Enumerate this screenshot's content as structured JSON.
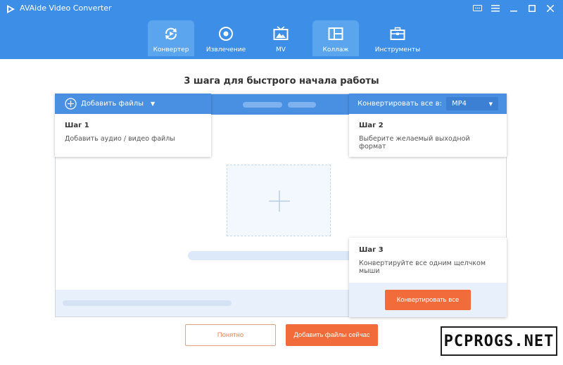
{
  "window": {
    "title": "AVAide Video Converter",
    "controls": [
      "feedback",
      "menu",
      "minimize",
      "maximize",
      "close"
    ]
  },
  "nav": {
    "tabs": [
      {
        "label": "Конвертер",
        "icon": "convert-icon",
        "active": true
      },
      {
        "label": "Извлечение",
        "icon": "rip-icon",
        "active": false
      },
      {
        "label": "MV",
        "icon": "mv-icon",
        "active": false
      },
      {
        "label": "Коллаж",
        "icon": "collage-icon",
        "active": false
      },
      {
        "label": "Инструменты",
        "icon": "toolbox-icon",
        "active": false
      }
    ]
  },
  "tutorial": {
    "headline": "3 шага для быстрого начала работы",
    "add_files_label": "Добавить файлы",
    "convert_all_to_label": "Конвертировать все в:",
    "format_value": "MP4",
    "steps": [
      {
        "title": "Шаг 1",
        "desc": "Добавить аудио / видео файлы"
      },
      {
        "title": "Шаг 2",
        "desc": "Выберите желаемый выходной формат"
      },
      {
        "title": "Шаг 3",
        "desc": "Конвертируйте все одним щелчком мыши"
      }
    ],
    "convert_all_button": "Конвертировать все",
    "got_it_button": "Понятно",
    "add_now_button": "Добавить файлы сейчас"
  },
  "colors": {
    "header_blue": "#3d8ee6",
    "accent_blue": "#4a90e2",
    "accent_orange": "#f26b3a"
  },
  "watermark": "PCPROGS.NET"
}
